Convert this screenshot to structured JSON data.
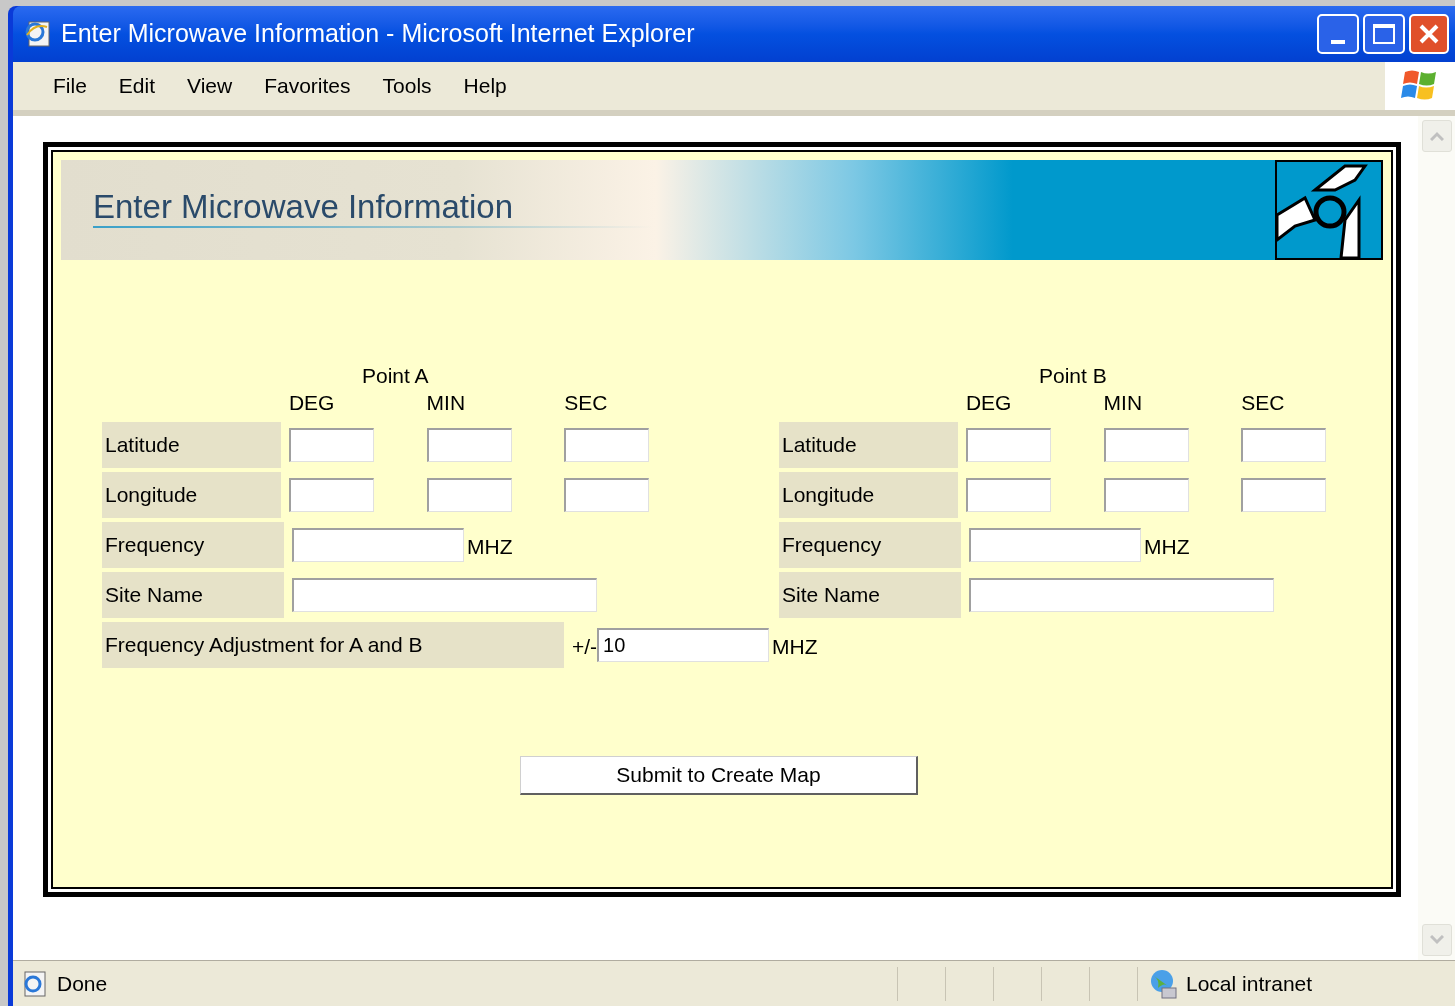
{
  "window": {
    "title": "Enter Microwave Information - Microsoft Internet Explorer"
  },
  "menu": [
    "File",
    "Edit",
    "View",
    "Favorites",
    "Tools",
    "Help"
  ],
  "page": {
    "heading": "Enter Microwave Information",
    "points": [
      {
        "title": "Point A",
        "columns": [
          "DEG",
          "MIN",
          "SEC"
        ],
        "rows": [
          {
            "label": "Latitude",
            "kind": "dms"
          },
          {
            "label": "Longitude",
            "kind": "dms"
          },
          {
            "label": "Frequency",
            "kind": "frequency",
            "unit": "MHZ"
          },
          {
            "label": "Site Name",
            "kind": "text"
          }
        ]
      },
      {
        "title": "Point B",
        "columns": [
          "DEG",
          "MIN",
          "SEC"
        ],
        "rows": [
          {
            "label": "Latitude",
            "kind": "dms"
          },
          {
            "label": "Longitude",
            "kind": "dms"
          },
          {
            "label": "Frequency",
            "kind": "frequency",
            "unit": "MHZ"
          },
          {
            "label": "Site Name",
            "kind": "text"
          }
        ]
      }
    ],
    "adjustment": {
      "label": "Frequency Adjustment for A and B",
      "prefix": "+/-",
      "value": "10",
      "unit": "MHZ"
    },
    "submit": "Submit to Create Map"
  },
  "status_bar": {
    "text": "Done",
    "zone": "Local intranet"
  }
}
